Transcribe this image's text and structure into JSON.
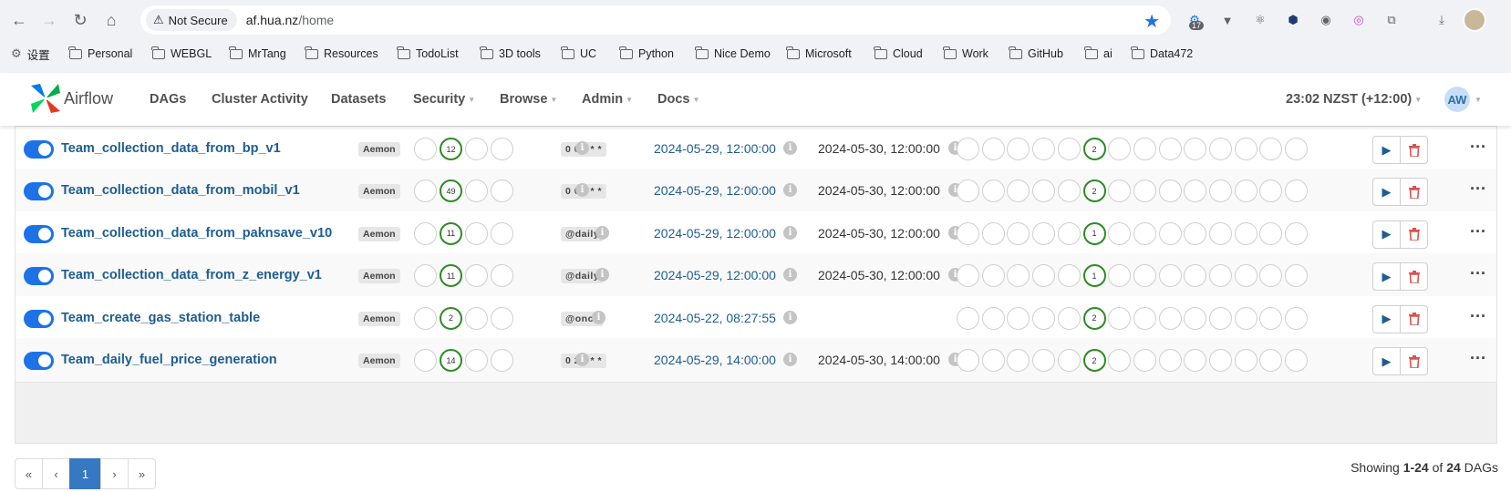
{
  "browser": {
    "security_label": "Not Secure",
    "url_host": "af.hua.nz",
    "url_path": "/home",
    "extension_badge": "17",
    "bookmarks": [
      {
        "label": "设置",
        "type": "settings"
      },
      {
        "label": "Personal",
        "type": "folder"
      },
      {
        "label": "WEBGL",
        "type": "folder"
      },
      {
        "label": "MrTang",
        "type": "folder"
      },
      {
        "label": "Resources",
        "type": "folder"
      },
      {
        "label": "TodoList",
        "type": "folder"
      },
      {
        "label": "3D tools",
        "type": "folder"
      },
      {
        "label": "UC",
        "type": "folder"
      },
      {
        "label": "Python",
        "type": "folder"
      },
      {
        "label": "Nice Demo",
        "type": "folder"
      },
      {
        "label": "Microsoft",
        "type": "folder"
      },
      {
        "label": "Cloud",
        "type": "folder"
      },
      {
        "label": "Work",
        "type": "folder"
      },
      {
        "label": "GitHub",
        "type": "folder"
      },
      {
        "label": "ai",
        "type": "folder"
      },
      {
        "label": "Data472",
        "type": "folder"
      }
    ]
  },
  "header": {
    "brand": "Airflow",
    "menu": [
      {
        "label": "DAGs",
        "dropdown": false
      },
      {
        "label": "Cluster Activity",
        "dropdown": false
      },
      {
        "label": "Datasets",
        "dropdown": false
      },
      {
        "label": "Security",
        "dropdown": true
      },
      {
        "label": "Browse",
        "dropdown": true
      },
      {
        "label": "Admin",
        "dropdown": true
      },
      {
        "label": "Docs",
        "dropdown": true
      }
    ],
    "clock": "23:02 NZST (+12:00)",
    "user_initials": "AW"
  },
  "dags": [
    {
      "name": "Team_collection_data_from_bp_v1",
      "owner": "Aemon",
      "runs_success": "12",
      "schedule": "0 0 * * *",
      "last_run": "2024-05-29, 12:00:00",
      "next_run": "2024-05-30, 12:00:00",
      "recent_tasks_success": "2"
    },
    {
      "name": "Team_collection_data_from_mobil_v1",
      "owner": "Aemon",
      "runs_success": "49",
      "schedule": "0 0 * * *",
      "last_run": "2024-05-29, 12:00:00",
      "next_run": "2024-05-30, 12:00:00",
      "recent_tasks_success": "2"
    },
    {
      "name": "Team_collection_data_from_paknsave_v10",
      "owner": "Aemon",
      "runs_success": "11",
      "schedule": "@daily",
      "last_run": "2024-05-29, 12:00:00",
      "next_run": "2024-05-30, 12:00:00",
      "recent_tasks_success": "1"
    },
    {
      "name": "Team_collection_data_from_z_energy_v1",
      "owner": "Aemon",
      "runs_success": "11",
      "schedule": "@daily",
      "last_run": "2024-05-29, 12:00:00",
      "next_run": "2024-05-30, 12:00:00",
      "recent_tasks_success": "1"
    },
    {
      "name": "Team_create_gas_station_table",
      "owner": "Aemon",
      "runs_success": "2",
      "schedule": "@once",
      "last_run": "2024-05-22, 08:27:55",
      "next_run": "",
      "recent_tasks_success": "2"
    },
    {
      "name": "Team_daily_fuel_price_generation",
      "owner": "Aemon",
      "runs_success": "14",
      "schedule": "0 2 * * *",
      "last_run": "2024-05-29, 14:00:00",
      "next_run": "2024-05-30, 14:00:00",
      "recent_tasks_success": "2"
    }
  ],
  "pagination": {
    "first": "«",
    "prev": "‹",
    "current": "1",
    "next": "›",
    "last": "»",
    "showing_prefix": "Showing ",
    "showing_range": "1-24",
    "showing_of": " of ",
    "showing_total": "24",
    "showing_suffix": " DAGs"
  },
  "colors": {
    "accent": "#1d72e8",
    "link": "#1d5d91",
    "success": "#2e8b24",
    "danger": "#d9534f",
    "active_page": "#3778c2"
  }
}
